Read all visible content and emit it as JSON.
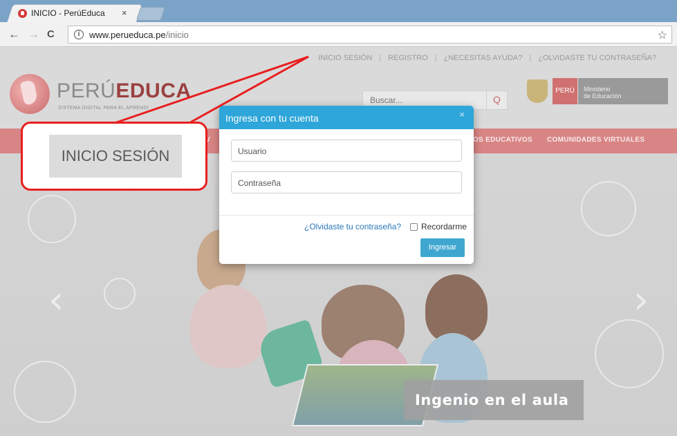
{
  "browser": {
    "tab_title": "INICIO - PerúEduca",
    "tab_close": "×",
    "url_host": "www.perueduca.pe",
    "url_path": "/inicio",
    "back": "←",
    "forward": "→",
    "reload": "C",
    "info": "i",
    "star": "☆"
  },
  "topnav": {
    "login": "INICIO SESIÓN",
    "sep": "|",
    "register": "REGISTRO",
    "help": "¿NECESITAS AYUDA?",
    "forgot": "¿OLVIDASTE TU CONTRASEÑA?"
  },
  "logo": {
    "light": "PERÚ",
    "bold": "EDUCA",
    "subtitle": "SISTEMA DIGITAL PARA EL APRENDI"
  },
  "search": {
    "placeholder": "Buscar...",
    "icon": "Q"
  },
  "gov": {
    "peru": "PERÚ",
    "ministry_line1": "Ministerio",
    "ministry_line2": "de Educación"
  },
  "mainnav": {
    "item_left": "A V",
    "item_resources": "OS EDUCATIVOS",
    "item_communities": "COMUNIDADES VIRTUALES"
  },
  "hero": {
    "caption": "Ingenio en el aula",
    "prev": "‹",
    "next": "›"
  },
  "modal": {
    "title": "Ingresa con tu cuenta",
    "close": "×",
    "username_placeholder": "Usuario",
    "password_placeholder": "Contraseña",
    "forgot_link": "¿Olvidaste tu contraseña?",
    "remember_label": "Recordarme",
    "submit_label": "Ingresar"
  },
  "callout": {
    "label": "INICIO SESIÓN",
    "color": "#e81e1e"
  },
  "colors": {
    "modal_header": "#2ea6d9",
    "button": "#3fa7cf",
    "nav_bar": "#d98585"
  }
}
